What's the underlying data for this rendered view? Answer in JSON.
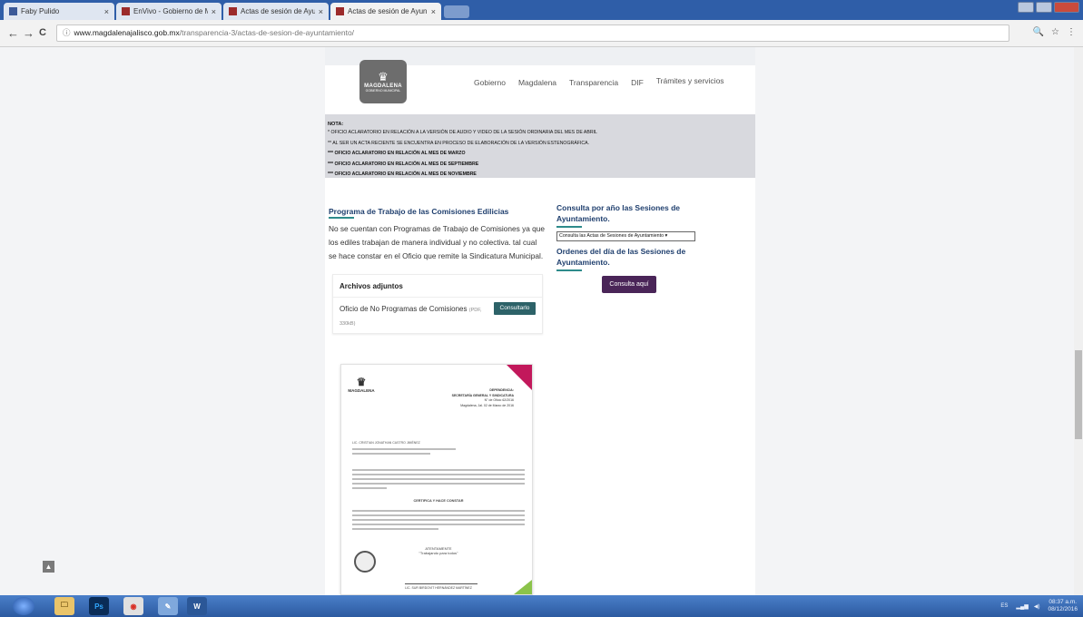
{
  "browser": {
    "tabs": [
      {
        "title": "Faby Pulido",
        "active": false
      },
      {
        "title": "EnVivo - Gobierno de M",
        "active": false
      },
      {
        "title": "Actas de sesión de Ayun",
        "active": false
      },
      {
        "title": "Actas de sesión de Ayun",
        "active": true
      }
    ],
    "close_glyph": "×",
    "address": {
      "domain": "www.magdalenajalisco.gob.mx",
      "path": "/transparencia-3/actas-de-sesion-de-ayuntamiento/"
    },
    "back_glyph": "←",
    "forward_glyph": "→",
    "reload_glyph": "C",
    "info_glyph": "ⓘ",
    "zoom_glyph": "🔍",
    "star_glyph": "☆",
    "menu_glyph": "⋮"
  },
  "site": {
    "logo": {
      "mark": "♛",
      "name": "MAGDALENA",
      "sub": "GOBIERNO MUNICIPAL"
    },
    "nav": [
      "Gobierno",
      "Magdalena",
      "Transparencia",
      "DIF",
      "Trámites y servicios"
    ]
  },
  "notice": {
    "heading": "NOTA:",
    "lines": [
      "* OFICIO ACLARATORIO EN RELACIÓN A LA VERSIÓN DE AUDIO Y VIDEO DE LA SESIÓN ORDINARIA DEL MES DE ABRIL",
      "** AL SER UN ACTA RECIENTE SE ENCUENTRA EN PROCESO DE ELABORACIÓN DE LA VERSIÓN ESTENOGRÁFICA.",
      "*** OFICIO ACLARATORIO EN RELACIÓN AL MES DE MARZO",
      "*** OFICIO ACLARATORIO EN RELACIÓN AL MES DE SEPTIEMBRE",
      "*** OFICIO ACLARATORIO EN RELACIÓN AL MES DE NOVIEMBRE"
    ]
  },
  "left": {
    "title": "Programa de Trabajo de las Comisiones Edilicias",
    "paragraph": "No se cuentan con Programas de Trabajo de Comisiones ya que los ediles trabajan de manera individual y no colectiva. tal cual se hace constar en el Oficio que remite la Sindicatura Municipal.",
    "attachments": {
      "header": "Archivos adjuntos",
      "file_name": "Oficio de No Programas de Comisiones",
      "file_type": "(PDF,",
      "file_size": "330kB)",
      "button": "Consultarlo"
    }
  },
  "right": {
    "title1": "Consulta por año las Sesiones de Ayuntamiento.",
    "select_value": "Consulta las Actas de Sesiones de Ayuntamiento ▾",
    "title2": "Ordenes del día de las Sesiones de Ayuntamiento.",
    "button": "Consulta aquí"
  },
  "document": {
    "logo_name": "MAGDALENA",
    "dependency_label": "DEPENDENCIA:",
    "dependency": "SECRETARÍA GENERAL Y SINDICATURA",
    "office_no": "N° de Oficio 62/2016",
    "place_date": "Magdalena, Jal. 02 de Marzo de 2016",
    "addressee": "LIC. CRISTIAN JONATHAN CASTRO JIMÉNEZ",
    "certify": "CERTIFICA Y HACE CONSTAR",
    "closing": "ATENTAMENTE",
    "motto": "\"Trabajando para todos\"",
    "signer": "LIC. SUR BIRDOVIT HERNÁNDEZ MARTÍNEZ"
  },
  "taskbar": {
    "apps": [
      "🗀",
      "Ps",
      "◉",
      "✎",
      "W"
    ],
    "tray_lang": "ES",
    "time": "08:37 a.m.",
    "date": "08/12/2016"
  },
  "colors": {
    "tabbar": "#2f5ea8",
    "teal_button": "#2d6268",
    "purple_button": "#4a2558",
    "title_blue": "#1f3f6e"
  }
}
